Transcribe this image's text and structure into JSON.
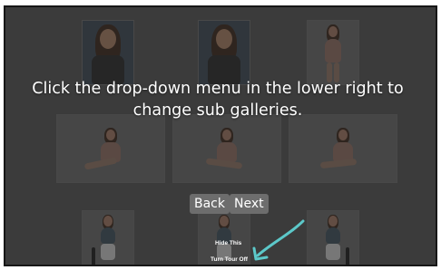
{
  "tour": {
    "message": "Click the drop-down menu in the lower right to change sub galleries.",
    "back_label": "Back",
    "next_label": "Next",
    "hide_label": "Hide This",
    "turn_off_label": "Turn Tour Off"
  },
  "colors": {
    "overlay": "#535353",
    "arrow": "#5cc8c9",
    "button_bg": "#6d6d6d"
  }
}
